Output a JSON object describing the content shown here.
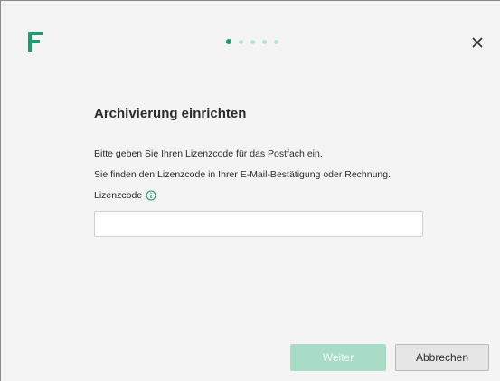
{
  "header": {
    "logo_icon": "f-logo-icon",
    "brand_color": "#1f9a70",
    "progress": {
      "total_steps": 5,
      "current_step": 1
    },
    "close_icon": "close-icon"
  },
  "main": {
    "title": "Archivierung einrichten",
    "line1": "Bitte geben Sie Ihren Lizenzcode für das Postfach ein.",
    "line2": "Sie finden den Lizenzcode in Ihrer E-Mail-Bestätigung oder Rechnung.",
    "license_label": "Lizenzcode",
    "license_info_icon": "info-icon",
    "license_value": ""
  },
  "footer": {
    "next_label": "Weiter",
    "next_enabled": false,
    "cancel_label": "Abbrechen"
  }
}
